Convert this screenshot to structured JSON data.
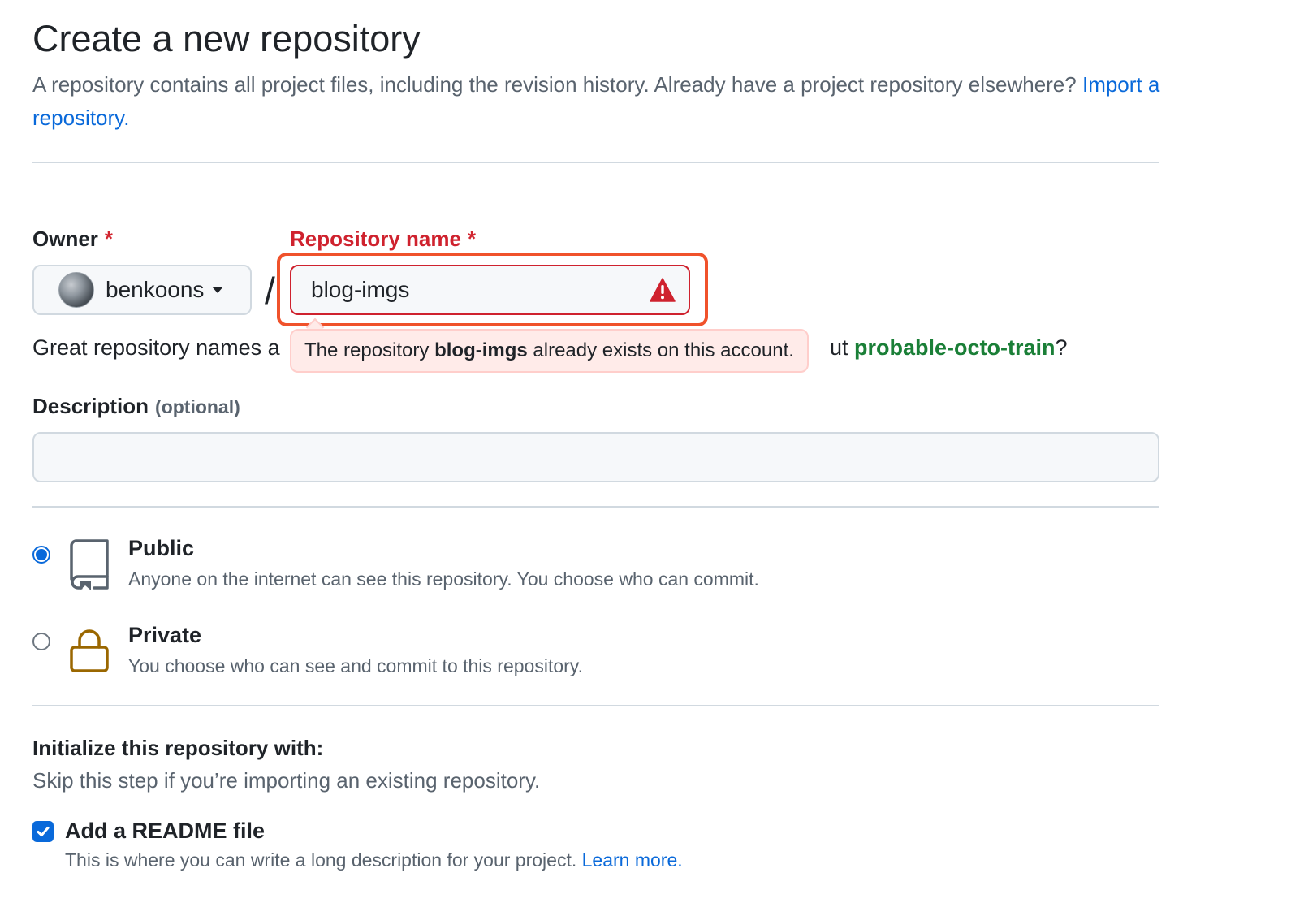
{
  "header": {
    "title": "Create a new repository",
    "intro_text": "A repository contains all project files, including the revision history. Already have a project repository elsewhere?",
    "import_link": "Import a repository."
  },
  "owner": {
    "label": "Owner",
    "required_mark": "*",
    "selected": "benkoons",
    "avatar_icon": "user-avatar"
  },
  "separator": "/",
  "repo_name": {
    "label": "Repository name",
    "required_mark": "*",
    "value": "blog-imgs",
    "warning_icon": "alert-triangle-icon",
    "error": {
      "prefix": "The repository",
      "name": "blog-imgs",
      "suffix": "already exists on this account."
    }
  },
  "helper": {
    "text_visible_left": "Great repository names a",
    "text_visible_right": "ut",
    "suggestion": "probable-octo-train",
    "end": "?"
  },
  "description": {
    "label": "Description",
    "optional": "(optional)",
    "value": ""
  },
  "visibility": {
    "options": [
      {
        "title": "Public",
        "desc": "Anyone on the internet can see this repository. You choose who can commit.",
        "selected": true,
        "icon": "repo-icon"
      },
      {
        "title": "Private",
        "desc": "You choose who can see and commit to this repository.",
        "selected": false,
        "icon": "lock-icon"
      }
    ]
  },
  "init": {
    "title": "Initialize this repository with:",
    "desc": "Skip this step if you’re importing an existing repository.",
    "readme": {
      "label": "Add a README file",
      "checked": true,
      "desc": "This is where you can write a long description for your project.",
      "learn_more": "Learn more."
    }
  },
  "colors": {
    "accent": "#0969da",
    "error": "#cf222e",
    "highlight": "#f0522b",
    "suggestion": "#1a7f37",
    "lock": "#9a6700"
  }
}
